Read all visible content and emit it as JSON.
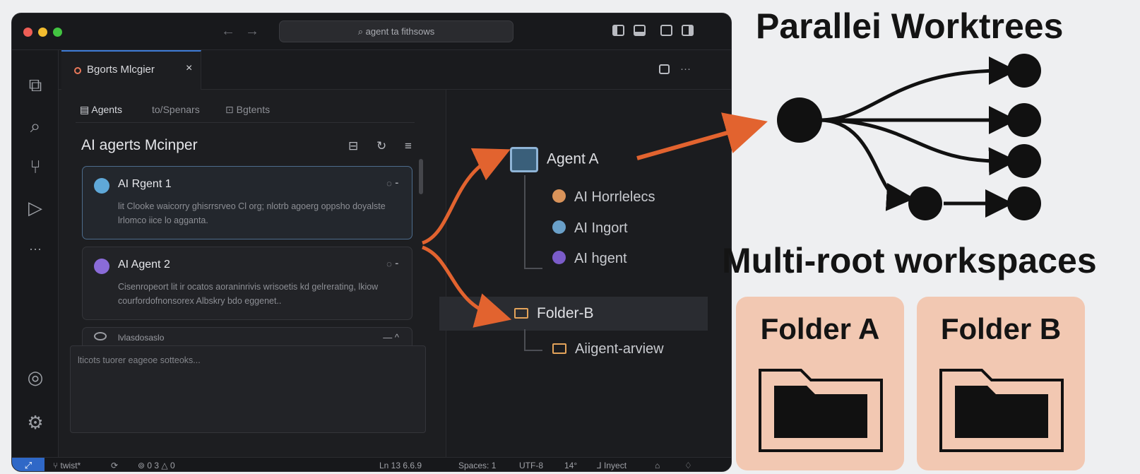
{
  "window": {
    "search_text": "agent ta fithsows",
    "tab_label": "Bgorts Mlcgier",
    "tab_close": "×",
    "tabbar_more": "···"
  },
  "panel": {
    "subtabs": [
      "Agents",
      "to/Spenars",
      "Bgtents"
    ],
    "title": "AI agerts Mcinper",
    "cards": [
      {
        "title": "AI Rgent 1",
        "desc": "lit Clooke waicorry ghisrrsrveo Cl org; nlotrb agoerg oppsho doyalste lrlomco iice lo agganta.",
        "icon_color": "#5fa8d8"
      },
      {
        "title": "AI Agent 2",
        "desc": "Cisenropeort lit ir ocatos aoraninrivis wrisoetis kd gelrerating, lkiow courfordofnonsorex Albskry bdo eggenet..",
        "icon_color": "#8a6bd8"
      },
      {
        "title": "lvlasdosaslo",
        "desc": "",
        "icon_color": "#9a9ca2"
      }
    ],
    "input_placeholder": "lticots tuorer eageoe sotteoks..."
  },
  "tree": {
    "agent_a": "Agent A",
    "children": [
      "AI Horrlelecs",
      "AI Ingort",
      "AI hgent"
    ],
    "folder_b": "Folder-B",
    "folder_child": "Aiigent-arview"
  },
  "statusbar": {
    "remote": "⤢",
    "branch": "twist*",
    "sync": "⟳",
    "problems": "⊚ 0 3 △ 0",
    "position": "Ln 13  6.6.9",
    "spaces": "Spaces: 1",
    "encoding": "UTF-8",
    "eol": "14°",
    "language": "Inyect"
  },
  "diagram": {
    "title_top": "Parallei Worktrees",
    "title_bottom": "Multi-root workspaces",
    "folder_a": "Folder A",
    "folder_b": "Folder B"
  },
  "colors": {
    "arrow": "#e2632f",
    "accent": "#3e7bd6",
    "folder_card": "#f2c8b2"
  }
}
